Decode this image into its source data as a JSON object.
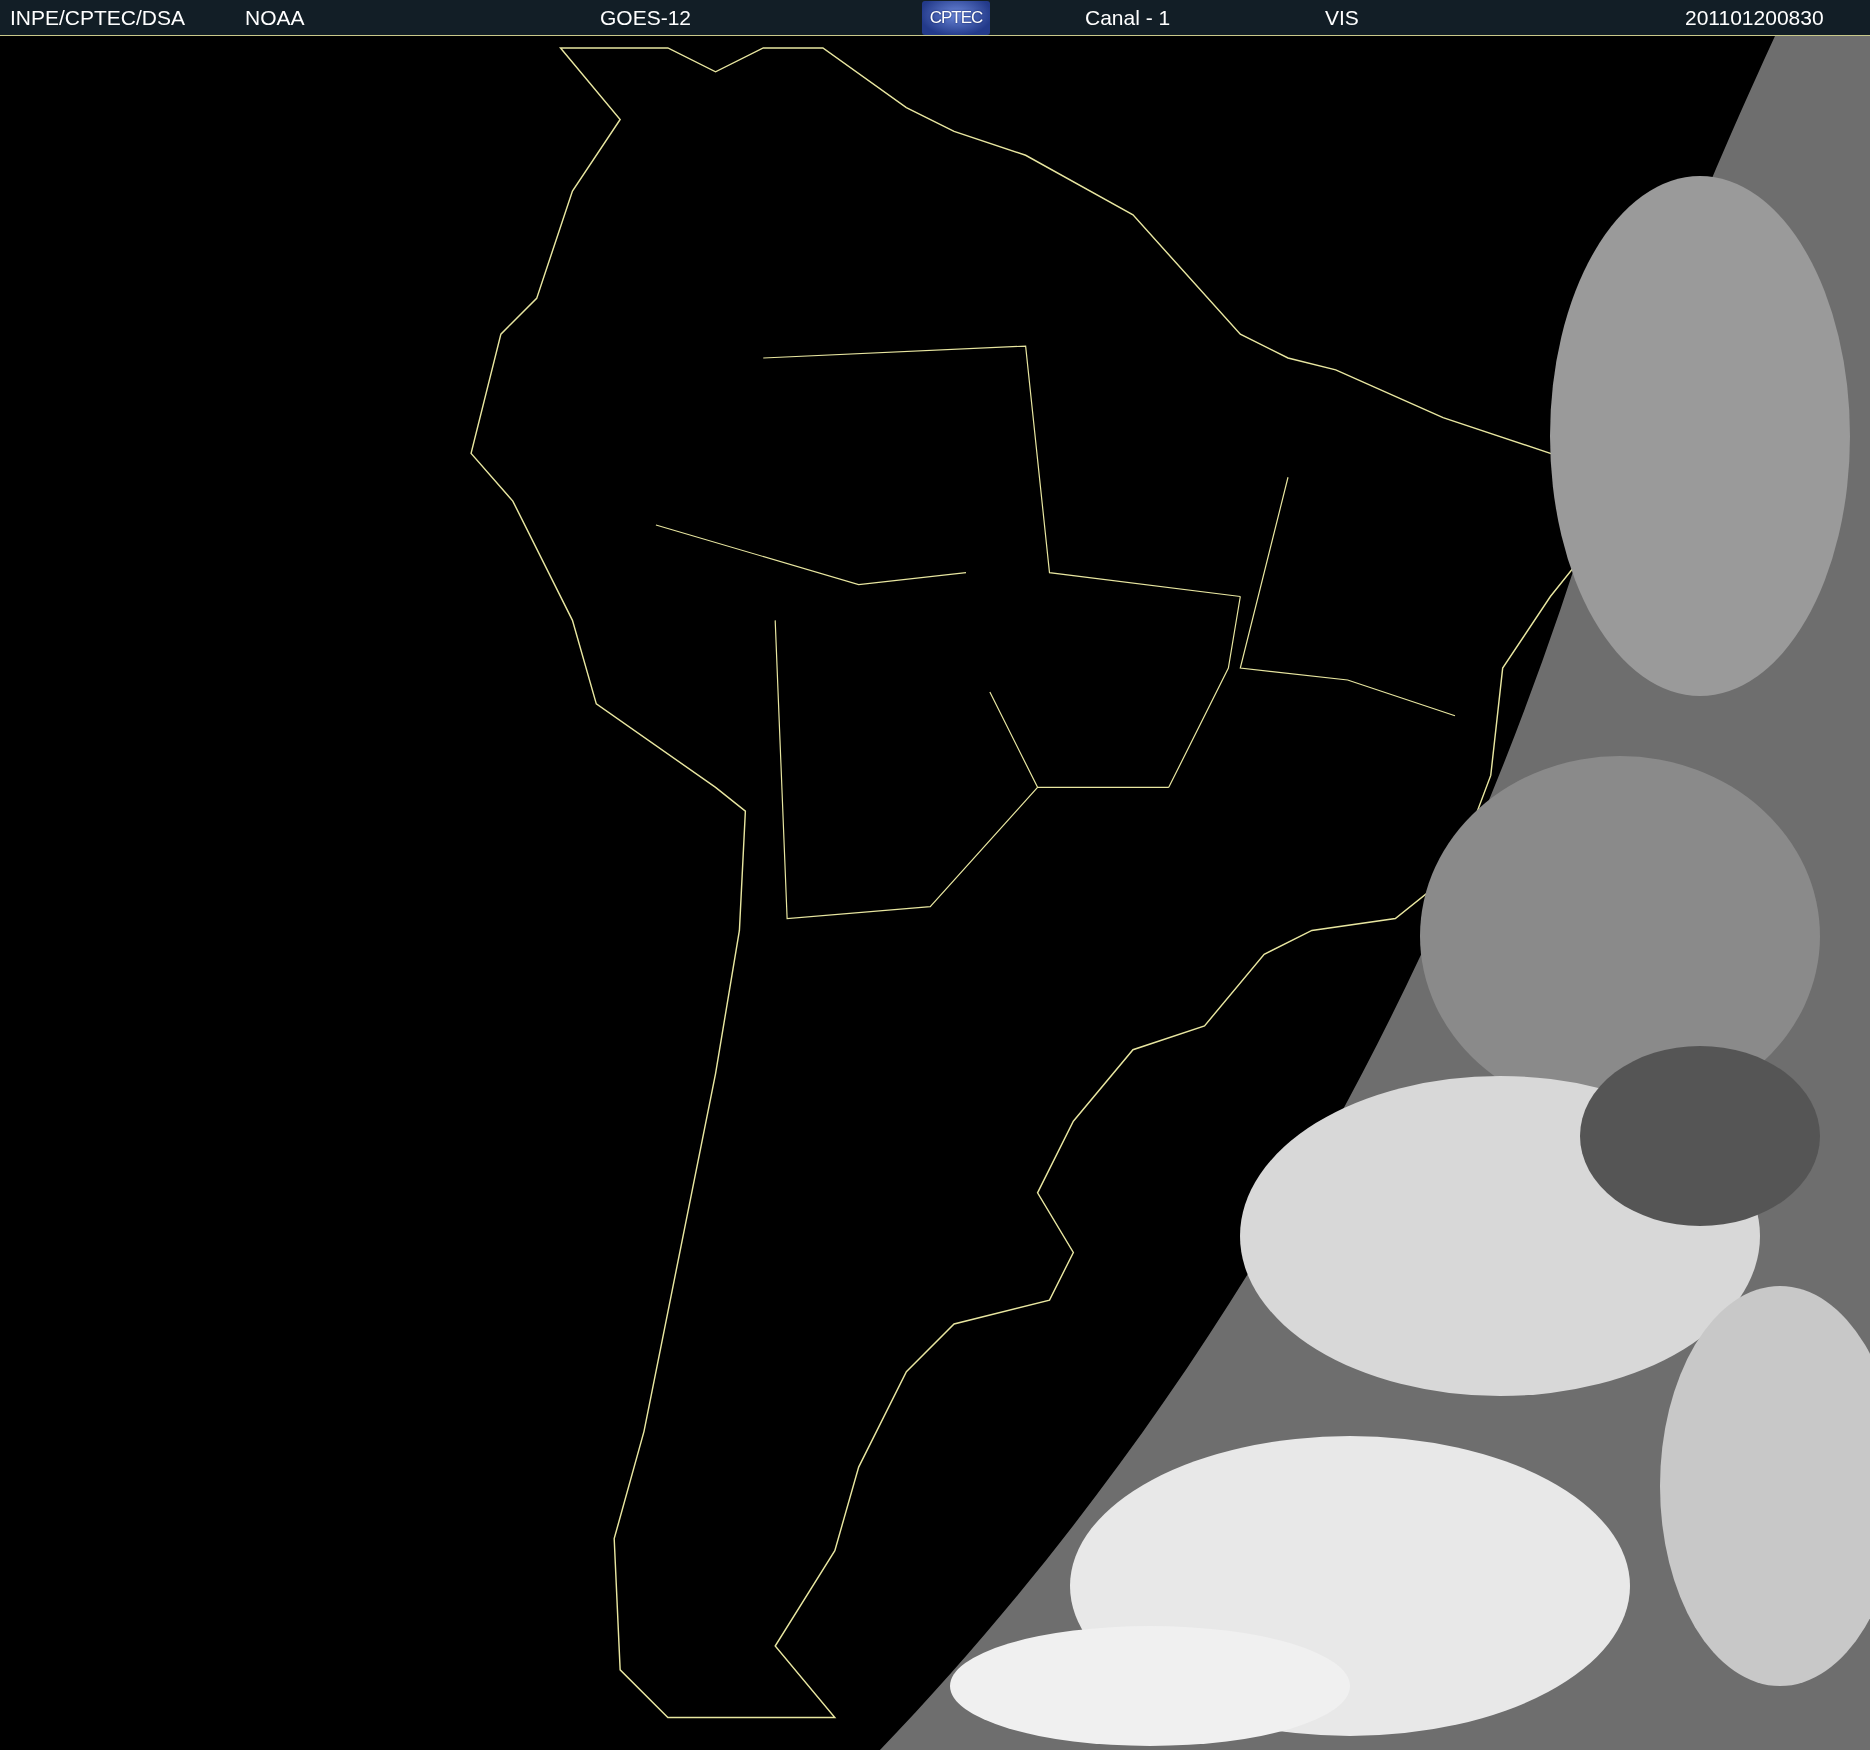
{
  "header": {
    "items": [
      {
        "kind": "text",
        "text": "INPE/CPTEC/DSA"
      },
      {
        "kind": "text",
        "text": "NOAA"
      },
      {
        "kind": "text",
        "text": "GOES-12"
      },
      {
        "kind": "logo",
        "text": "CPTEC"
      },
      {
        "kind": "text",
        "text": "Canal - 1"
      },
      {
        "kind": "text",
        "text": "VIS"
      },
      {
        "kind": "text",
        "text": "201101200830"
      }
    ]
  }
}
